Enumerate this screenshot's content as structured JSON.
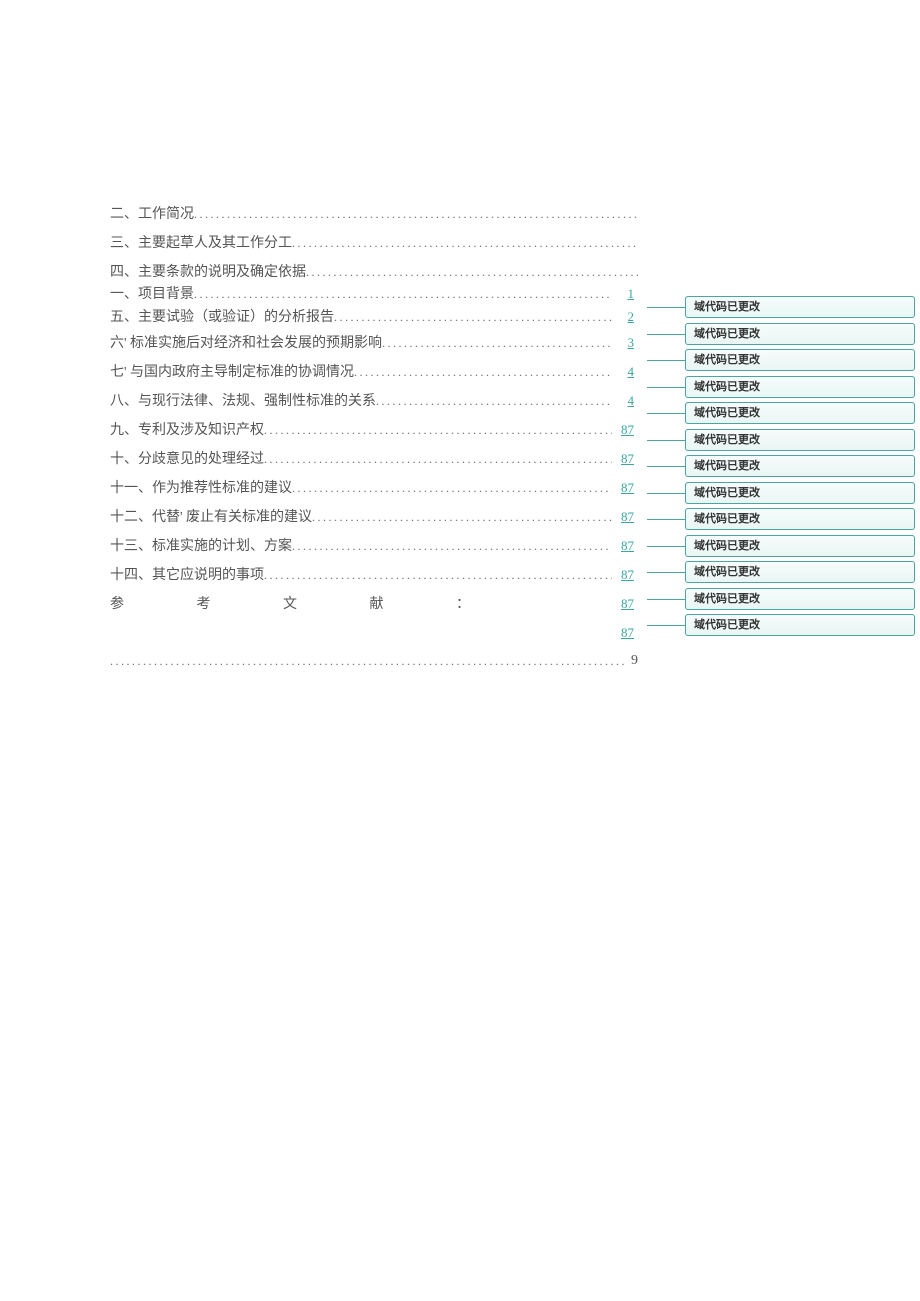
{
  "toc": {
    "groupA": [
      {
        "label": "二、工作简况",
        "page": ""
      },
      {
        "label": "三、主要起草人及其工作分工",
        "page": ""
      },
      {
        "label": "四、主要条款的说明及确定依据",
        "page": ""
      }
    ],
    "groupB": [
      {
        "label": "一、项目背景",
        "page": "1"
      },
      {
        "label": "五、主要试验（或验证）的分析报告",
        "page": "2"
      },
      {
        "label": "六' 标准实施后对经济和社会发展的预期影响",
        "page": "3"
      },
      {
        "label": "七' 与国内政府主导制定标准的协调情况",
        "page": "4"
      },
      {
        "label": "八、与现行法律、法规、强制性标准的关系",
        "page": "4"
      },
      {
        "label": "九、专利及涉及知识产权",
        "page": "87"
      },
      {
        "label": "十、分歧意见的处理经过",
        "page": "87"
      },
      {
        "label": "十一、作为推荐性标准的建议",
        "page": "87"
      },
      {
        "label": "十二、代替' 废止有关标准的建议",
        "page": "87"
      },
      {
        "label": "十三、标准实施的计划、方案",
        "page": "87"
      },
      {
        "label": "十四、其它应说明的事项",
        "page": "87"
      }
    ],
    "ref": {
      "c1": "参",
      "c2": "考",
      "c3": "文",
      "c4": "献",
      "c5": "：",
      "page": "87"
    },
    "extraPage": "87",
    "finalPage": "9"
  },
  "commentLabel": "域代码已更改",
  "commentCount": 13
}
